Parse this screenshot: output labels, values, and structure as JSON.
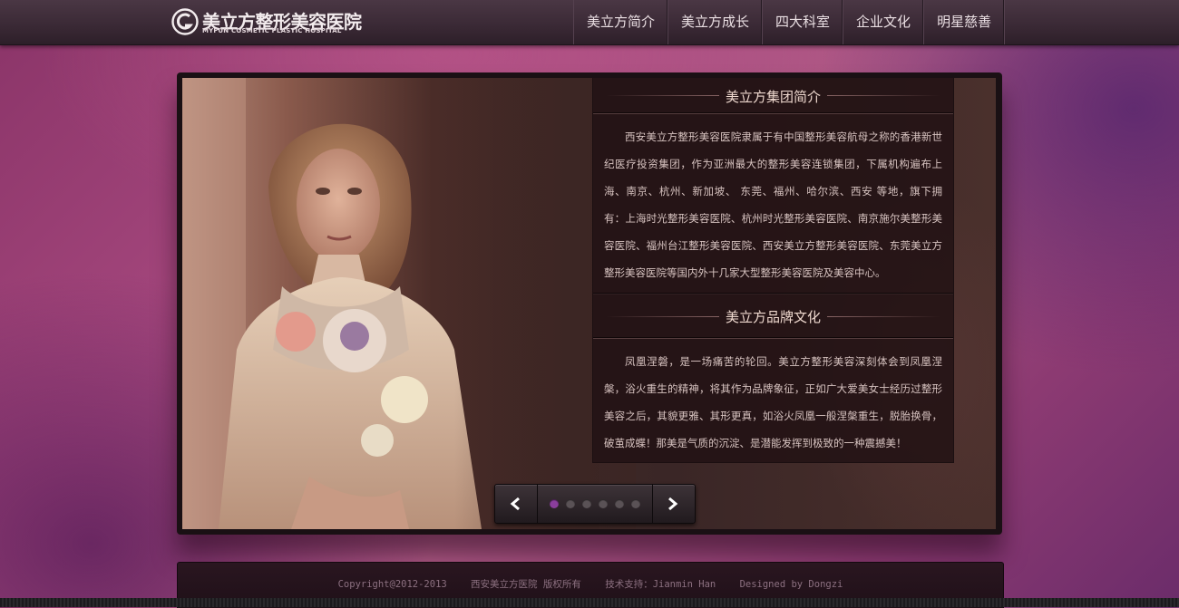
{
  "header": {
    "logo_cn": "美立方整形美容医院",
    "logo_en": "MYFUN COSMETIC PLASTIC HOSPITAL",
    "nav": [
      "美立方简介",
      "美立方成长",
      "四大科室",
      "企业文化",
      "明星慈善"
    ]
  },
  "slide": {
    "section1_title": "美立方集团简介",
    "section1_text": "西安美立方整形美容医院隶属于有中国整形美容航母之称的香港新世纪医疗投资集团，作为亚洲最大的整形美容连锁集团，下属机构遍布上海、南京、杭州、新加坡、 东莞、福州、哈尔滨、西安 等地，旗下拥有：上海时光整形美容医院、杭州时光整形美容医院、南京施尔美整形美容医院、福州台江整形美容医院、西安美立方整形美容医院、东莞美立方整形美容医院等国内外十几家大型整形美容医院及美容中心。",
    "section2_title": "美立方品牌文化",
    "section2_text": "凤凰涅磐，是一场痛苦的轮回。美立方整形美容深刻体会到凤凰涅槃，浴火重生的精神，将其作为品牌象征，正如广大爱美女士经历过整形美容之后，其貌更雅、其形更真，如浴火凤凰一般涅槃重生，脱胎换骨，破茧成蝶！那美是气质的沉淀、是潜能发挥到极致的一种震撼美！"
  },
  "controls": {
    "prev_icon": "chevron-left-icon",
    "next_icon": "chevron-right-icon",
    "dot_count": 6,
    "active_dot": 0
  },
  "footer": {
    "copyright": "Copyright@2012-2013",
    "owner": "西安美立方医院 版权所有",
    "tech": "技术支持：Jianmin Han",
    "design": "Designed by Dongzi"
  },
  "colors": {
    "accent_dot": "#8a3e9c",
    "background": "#a6487e"
  }
}
